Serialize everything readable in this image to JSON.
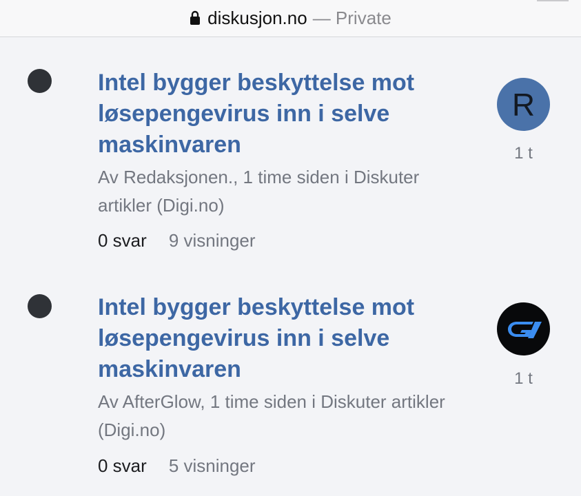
{
  "browser": {
    "domain": "diskusjon.no",
    "privacy_label": "— Private"
  },
  "topics": [
    {
      "title": "Intel bygger beskyttelse mot løsepengevirus inn i selve maskinvaren",
      "meta": "Av Redaksjonen., 1 time siden i Diskuter artikler (Digi.no)",
      "replies": "0 svar",
      "views": "9 visninger",
      "avatar_letter": "R",
      "avatar_color": "#4a72a9",
      "age": "1 t"
    },
    {
      "title": "Intel bygger beskyttelse mot løsepengevirus inn i selve maskinvaren",
      "meta": "Av AfterGlow, 1 time siden i Diskuter artikler (Digi.no)",
      "replies": "0 svar",
      "views": "5 visninger",
      "avatar_icon": "g-logo-icon",
      "age": "1 t"
    }
  ]
}
